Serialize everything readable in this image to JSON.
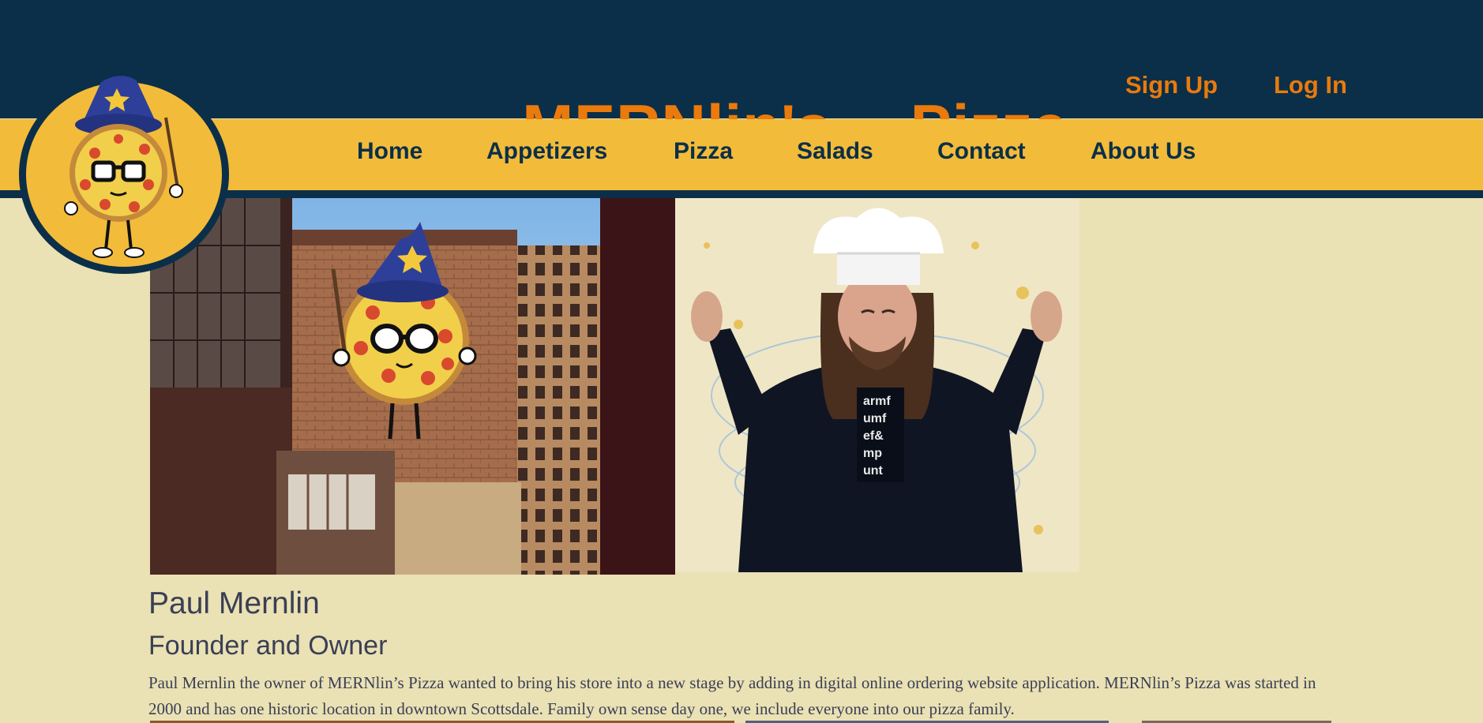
{
  "header": {
    "brand_word1": "MERNlin's",
    "brand_word2": "Pizza",
    "sign_up": "Sign Up",
    "log_in": "Log In"
  },
  "nav": {
    "items": [
      {
        "label": "Home"
      },
      {
        "label": "Appetizers"
      },
      {
        "label": "Pizza"
      },
      {
        "label": "Salads"
      },
      {
        "label": "Contact"
      },
      {
        "label": "About Us"
      }
    ]
  },
  "logo": {
    "icon": "wizard-pizza-mascot-icon"
  },
  "hero": {
    "left_image": "wizard-pizza-mural-photo",
    "right_image": "chef-wizard-photo"
  },
  "profile": {
    "name": "Paul Mernlin",
    "role": "Founder and Owner",
    "bio": "Paul Mernlin the owner of MERNlin’s Pizza wanted to bring his store into a new stage by adding in digital online ordering website application. MERNlin’s Pizza was started in 2000 and has one historic location in downtown Scottsdale. Family own sense day one, we include everyone into our pizza family."
  },
  "colors": {
    "header_bg": "#0b2f48",
    "nav_bg": "#f3bb3a",
    "accent_orange": "#ea7a0c",
    "page_bg": "#eae1b4",
    "text": "#3a3f55"
  }
}
